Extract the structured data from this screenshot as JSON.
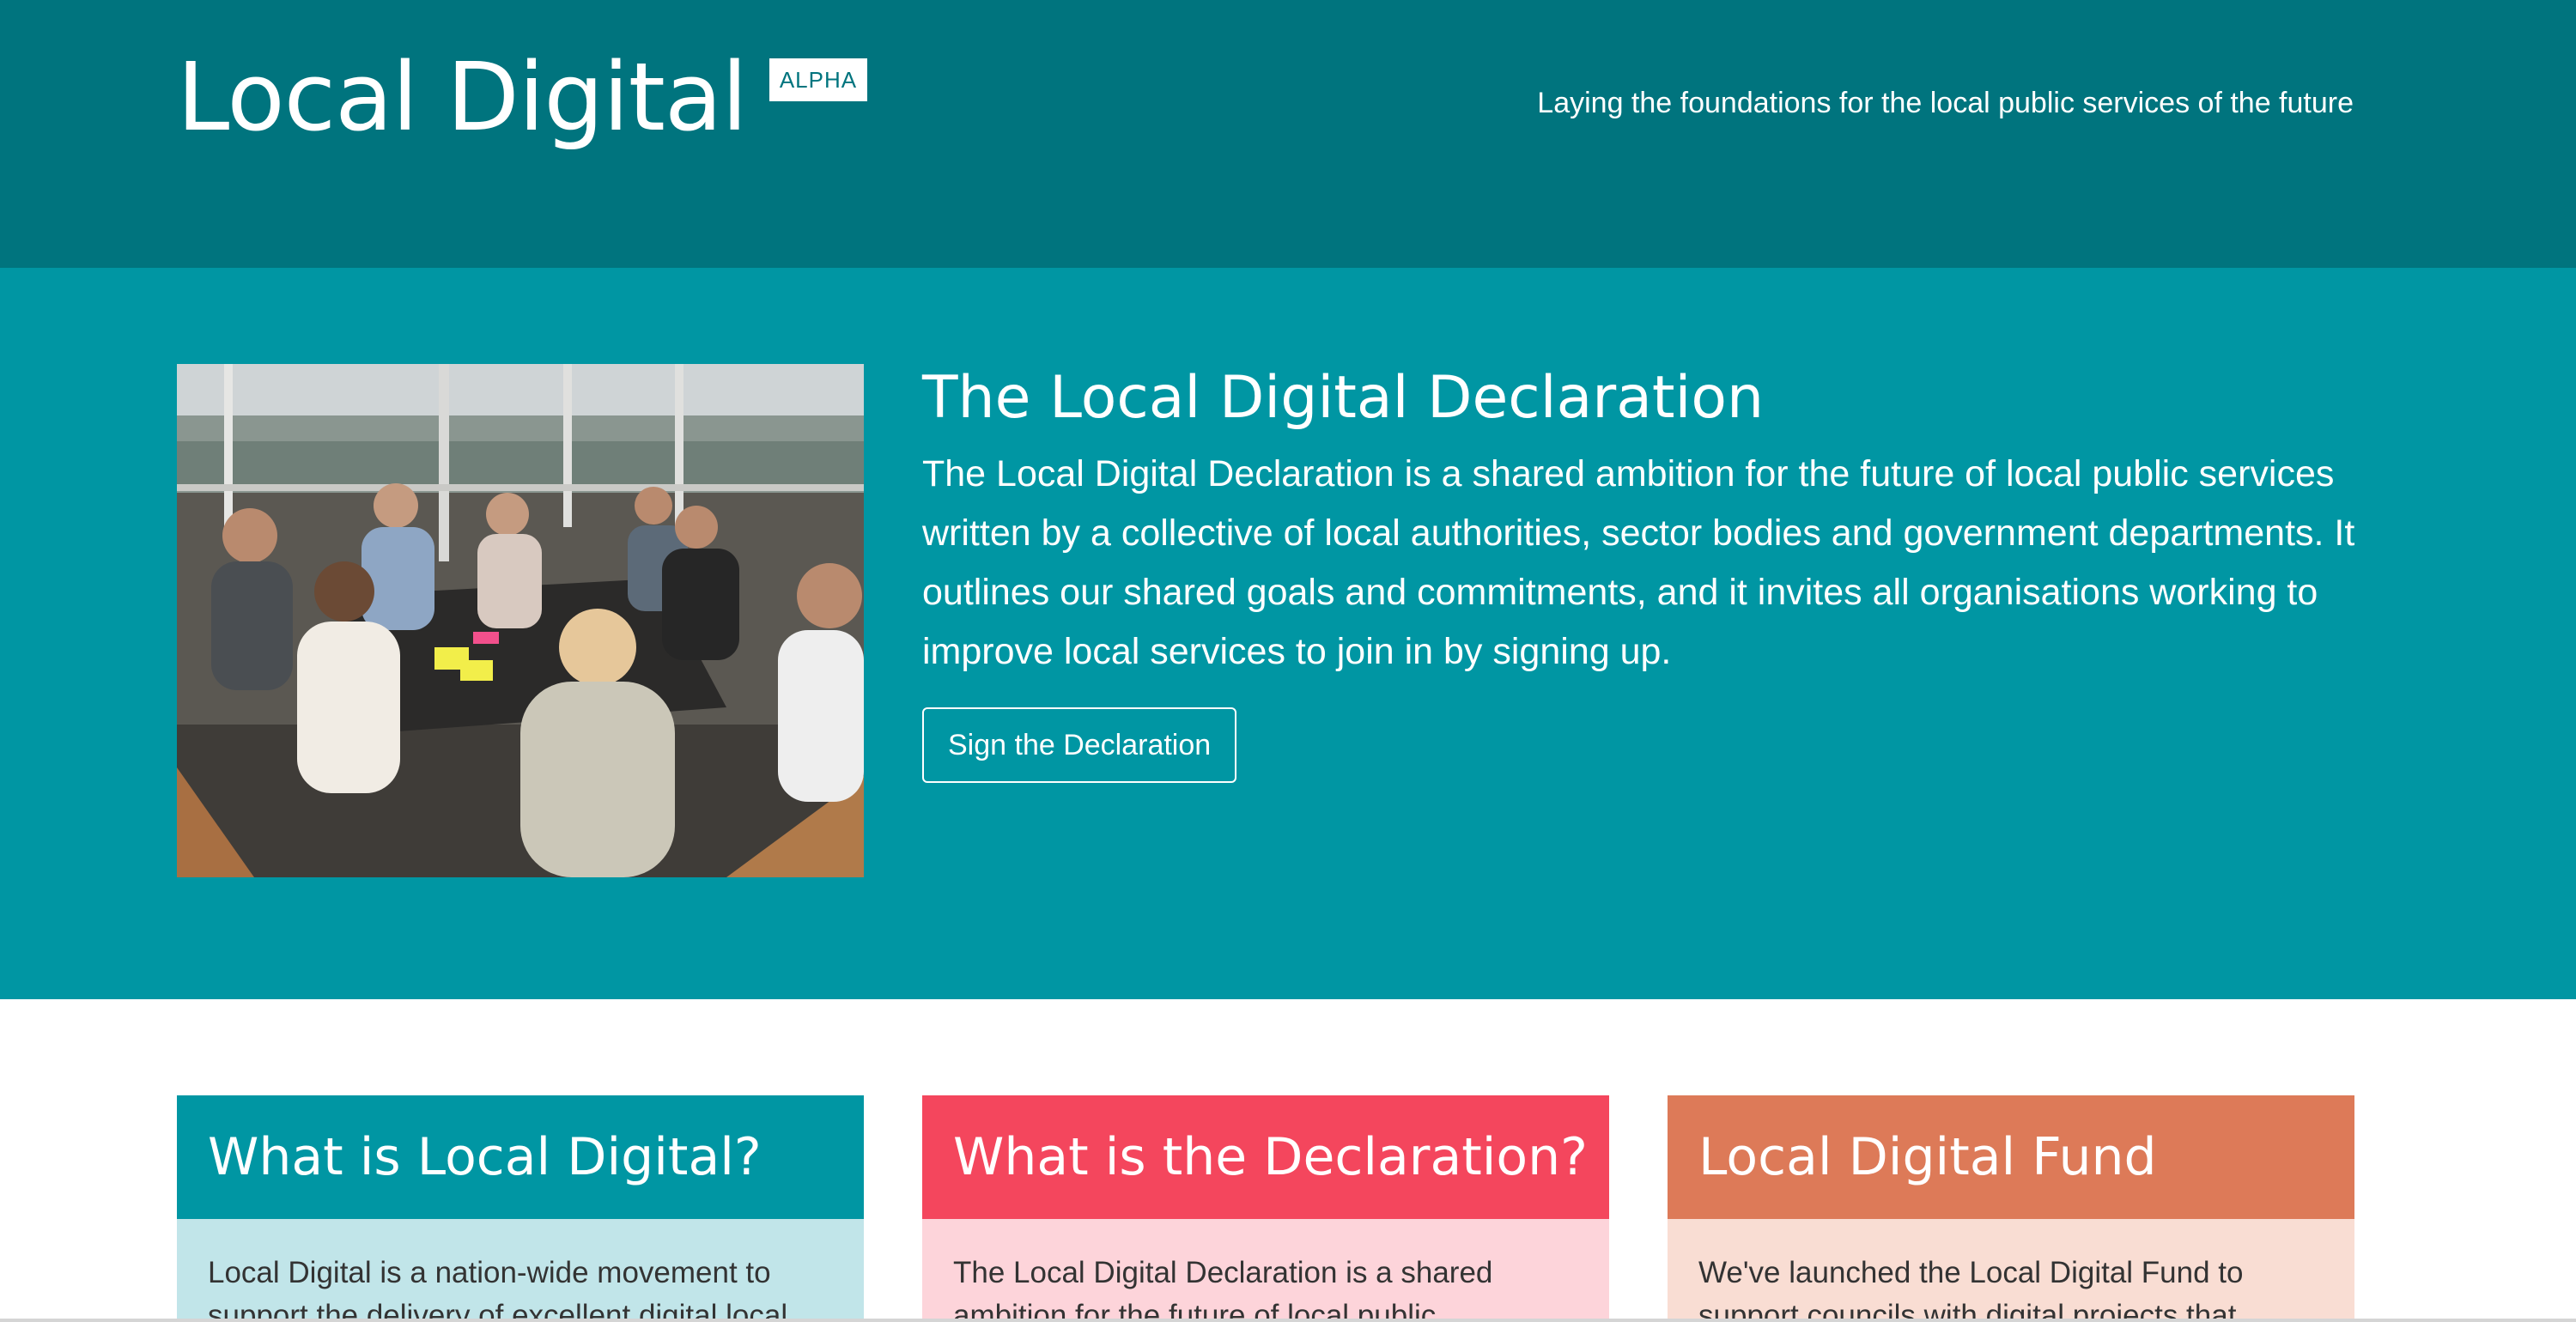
{
  "header": {
    "title": "Local Digital",
    "badge": "ALPHA",
    "tagline": "Laying the foundations for the local public services of the future"
  },
  "hero": {
    "title": "The Local Digital Declaration",
    "body": "The Local Digital Declaration is a shared ambition for the future of local public services written by a collective of local authorities, sector bodies and government departments. It outlines our shared goals and commitments, and it invites all organisations working to improve local services to join in by signing up.",
    "button_label": "Sign the Declaration",
    "image_alt": "People meeting around a table"
  },
  "cards": [
    {
      "title": "What is Local Digital?",
      "body": "Local Digital is a nation-wide movement to support the delivery of excellent digital local"
    },
    {
      "title": "What is the Declaration?",
      "body": "The Local Digital Declaration is a shared ambition for the future of local public"
    },
    {
      "title": "Local Digital Fund",
      "body": "We've launched the Local Digital Fund to support councils with digital projects that"
    }
  ],
  "colors": {
    "header_bg": "#00747e",
    "hero_bg": "#0096a3",
    "card1_accent": "#0096a3",
    "card2_accent": "#f4465d",
    "card3_accent": "#dd7a58"
  }
}
